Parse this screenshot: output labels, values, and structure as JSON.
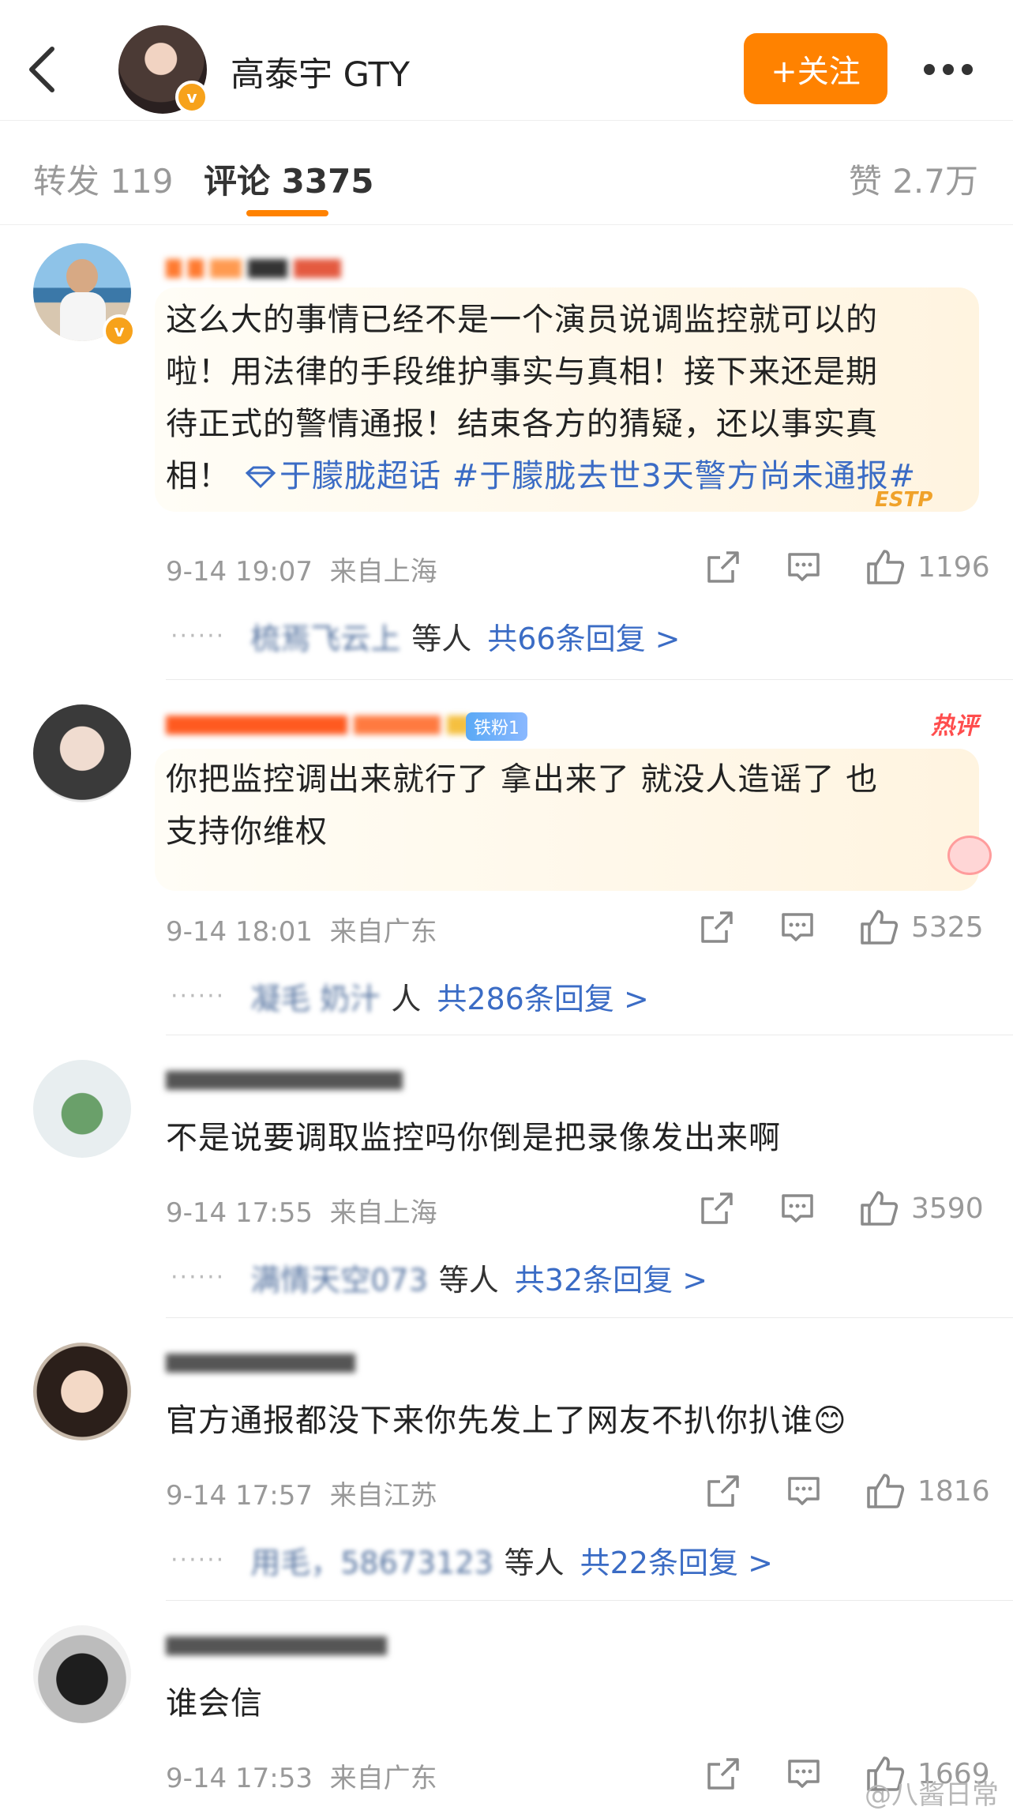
{
  "header": {
    "title": "高泰宇 GTY",
    "follow_label": "+关注"
  },
  "tabs": {
    "repost": "转发 119",
    "comment": "评论 3375",
    "like": "赞 2.7万"
  },
  "comments": [
    {
      "text_lines": [
        "这么大的事情已经不是一个演员说调监控就可以的",
        "啦！用法律的手段维护事实与真相！接下来还是期",
        "待正式的警情通报！结束各方的猜疑，还以事实真"
      ],
      "text_last": "相！",
      "topic": "于朦胧超话 #于朦胧去世3天警方尚未通报#",
      "decoration": "ESTP",
      "time": "9-14 19:07",
      "location": "来自上海",
      "likes": "1196",
      "reply_blur": "梳焉飞云上",
      "reply_etc": "等人",
      "reply_link": "共66条回复 >"
    },
    {
      "fan_badge": "铁粉1",
      "hot_label": "热评",
      "text_lines": [
        "你把监控调出来就行了 拿出来了  就没人造谣了  也",
        "支持你维权"
      ],
      "time": "9-14 18:01",
      "location": "来自广东",
      "likes": "5325",
      "reply_blur": "凝毛 奶汁",
      "reply_etc": "人",
      "reply_link": "共286条回复 >"
    },
    {
      "text_lines": [
        "不是说要调取监控吗你倒是把录像发出来啊"
      ],
      "time": "9-14 17:55",
      "location": "来自上海",
      "likes": "3590",
      "reply_blur": "满情天空073",
      "reply_etc": "等人",
      "reply_link": "共32条回复 >"
    },
    {
      "text_lines": [
        "官方通报都没下来你先发上了网友不扒你扒谁😊"
      ],
      "time": "9-14 17:57",
      "location": "来自江苏",
      "likes": "1816",
      "reply_blur": "用毛，58673123",
      "reply_etc": "等人",
      "reply_link": "共22条回复 >"
    },
    {
      "text_lines": [
        "谁会信"
      ],
      "time": "9-14 17:53",
      "location": "来自广东",
      "likes": "1669"
    }
  ],
  "watermark": "@八酱日常",
  "colors": {
    "accent": "#ff8200",
    "link": "#3b6cc5",
    "muted": "#999999"
  }
}
